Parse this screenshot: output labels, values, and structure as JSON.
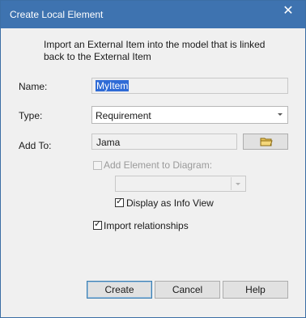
{
  "window": {
    "title": "Create Local Element",
    "close_glyph": "✕"
  },
  "intro": "Import an External Item into the model that is linked back to the External Item",
  "fields": {
    "name": {
      "label": "Name:",
      "value": "MyItem"
    },
    "type": {
      "label": "Type:",
      "value": "Requirement"
    },
    "add_to": {
      "label": "Add To:",
      "value": "Jama"
    }
  },
  "options": {
    "add_to_diagram": {
      "label": "Add Element to Diagram:",
      "checked": false,
      "enabled": false
    },
    "display_as_info_view": {
      "label": "Display as Info View",
      "checked": true
    },
    "import_relationships": {
      "label": "Import relationships",
      "checked": true
    }
  },
  "buttons": {
    "create": "Create",
    "cancel": "Cancel",
    "help": "Help"
  },
  "icons": {
    "folder": "folder-icon",
    "close": "close-icon",
    "dropdown": "chevron-down-icon"
  },
  "colors": {
    "title_bar": "#3e73b0",
    "selection": "#2f6bd6",
    "dialog_bg": "#f0f0f0"
  }
}
